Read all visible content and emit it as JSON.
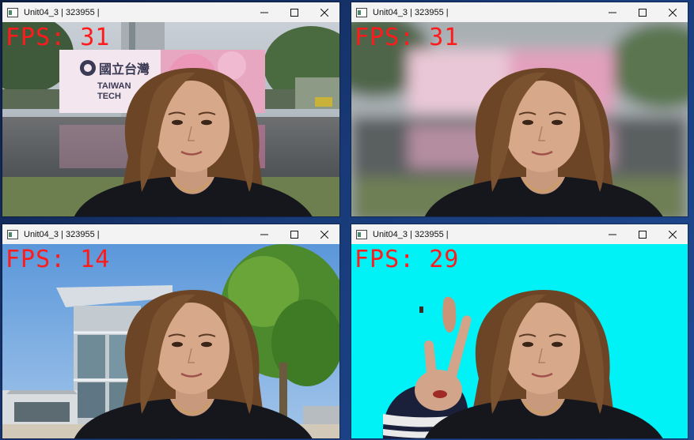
{
  "window_title": "Unit04_3 | 323955 |",
  "fps_color": "#ff1b1b",
  "accent": {
    "cyan_background": "#00f2f6",
    "desktop": "#183a78"
  },
  "icons": [
    "app-window-icon",
    "minimize-icon",
    "maximize-icon",
    "close-icon"
  ],
  "windows": [
    {
      "title": "Unit04_3 | 323955 |",
      "fps_label": "FPS:",
      "fps_value": "31",
      "scene": "original background (Taiwan Tech campus)"
    },
    {
      "title": "Unit04_3 | 323955 |",
      "fps_label": "FPS:",
      "fps_value": "31",
      "scene": "blurred background"
    },
    {
      "title": "Unit04_3 | 323955 |",
      "fps_label": "FPS:",
      "fps_value": "14",
      "scene": "replaced background (building and tree)"
    },
    {
      "title": "Unit04_3 | 323955 |",
      "fps_label": "FPS:",
      "fps_value": "29",
      "scene": "solid cyan background"
    }
  ],
  "signage": {
    "logo_line1": "TAIWAN",
    "logo_line2": "TECH"
  }
}
